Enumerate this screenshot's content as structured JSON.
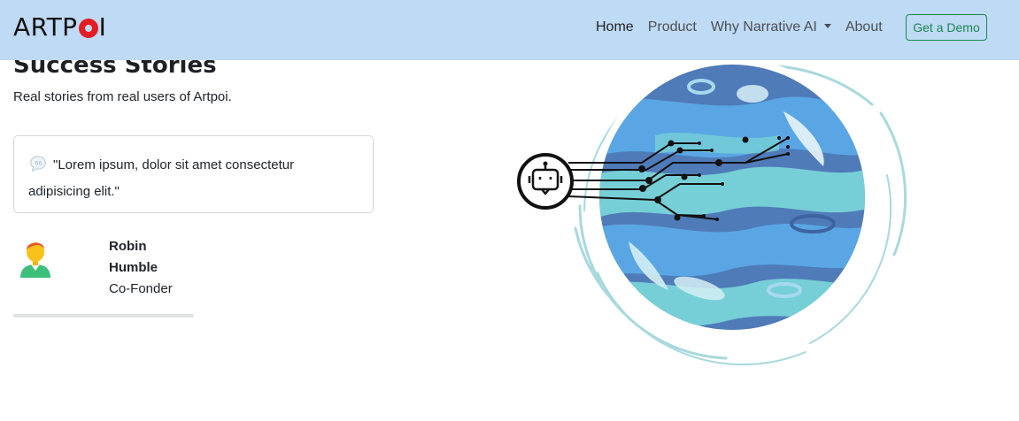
{
  "brand": {
    "name_part1": "ARTP",
    "name_part2": "I"
  },
  "nav": {
    "items": [
      {
        "label": "Home",
        "active": true
      },
      {
        "label": "Product"
      },
      {
        "label": "Why Narrative AI",
        "dropdown": true
      },
      {
        "label": "About"
      }
    ],
    "cta_label": "Get a Demo"
  },
  "hero": {
    "title": "Success Stories",
    "subtitle": "Real stories from real users of Artpoi."
  },
  "testimonial": {
    "quote": "\"Lorem ipsum, dolor sit amet consectetur adipisicing elit.\"",
    "author_name": "Robin Humble",
    "author_role": "Co-Fonder"
  },
  "colors": {
    "navbar_bg": "#bfdaf5",
    "brand_accent": "#e31b23",
    "cta": "#198754",
    "planet_dark": "#4f7bb9",
    "planet_mid": "#5aa6e4",
    "planet_teal": "#76cfd6",
    "ring": "#a9d9dc"
  }
}
